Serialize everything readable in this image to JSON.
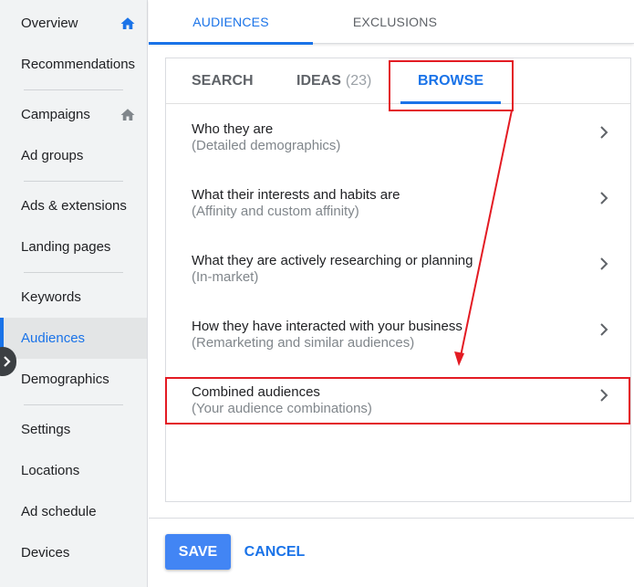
{
  "sidebar": {
    "items": [
      {
        "label": "Overview",
        "icon": "home-icon"
      },
      {
        "label": "Recommendations"
      },
      {
        "label": "Campaigns",
        "icon": "home-icon"
      },
      {
        "label": "Ad groups"
      },
      {
        "label": "Ads & extensions"
      },
      {
        "label": "Landing pages"
      },
      {
        "label": "Keywords"
      },
      {
        "label": "Audiences",
        "active": true
      },
      {
        "label": "Demographics"
      },
      {
        "label": "Settings"
      },
      {
        "label": "Locations"
      },
      {
        "label": "Ad schedule"
      },
      {
        "label": "Devices"
      }
    ],
    "collapse_icon": "chevron-right-icon"
  },
  "top_tabs": [
    {
      "label": "AUDIENCES",
      "active": true
    },
    {
      "label": "EXCLUSIONS"
    }
  ],
  "sub_tabs": {
    "search": "SEARCH",
    "ideas": "IDEAS",
    "ideas_count": "(23)",
    "browse": "BROWSE"
  },
  "browse_rows": [
    {
      "title": "Who they are",
      "subtitle": "(Detailed demographics)"
    },
    {
      "title": "What their interests and habits are",
      "subtitle": "(Affinity and custom affinity)"
    },
    {
      "title": "What they are actively researching or planning",
      "subtitle": "(In-market)"
    },
    {
      "title": "How they have interacted with your business",
      "subtitle": "(Remarketing and similar audiences)"
    },
    {
      "title": "Combined audiences",
      "subtitle": "(Your audience combinations)"
    }
  ],
  "actions": {
    "save": "SAVE",
    "cancel": "CANCEL"
  },
  "colors": {
    "accent": "#1a73e8",
    "save_button": "#4285f4",
    "annotation_red": "#e31b23",
    "sidebar_bg": "#f1f3f4"
  }
}
